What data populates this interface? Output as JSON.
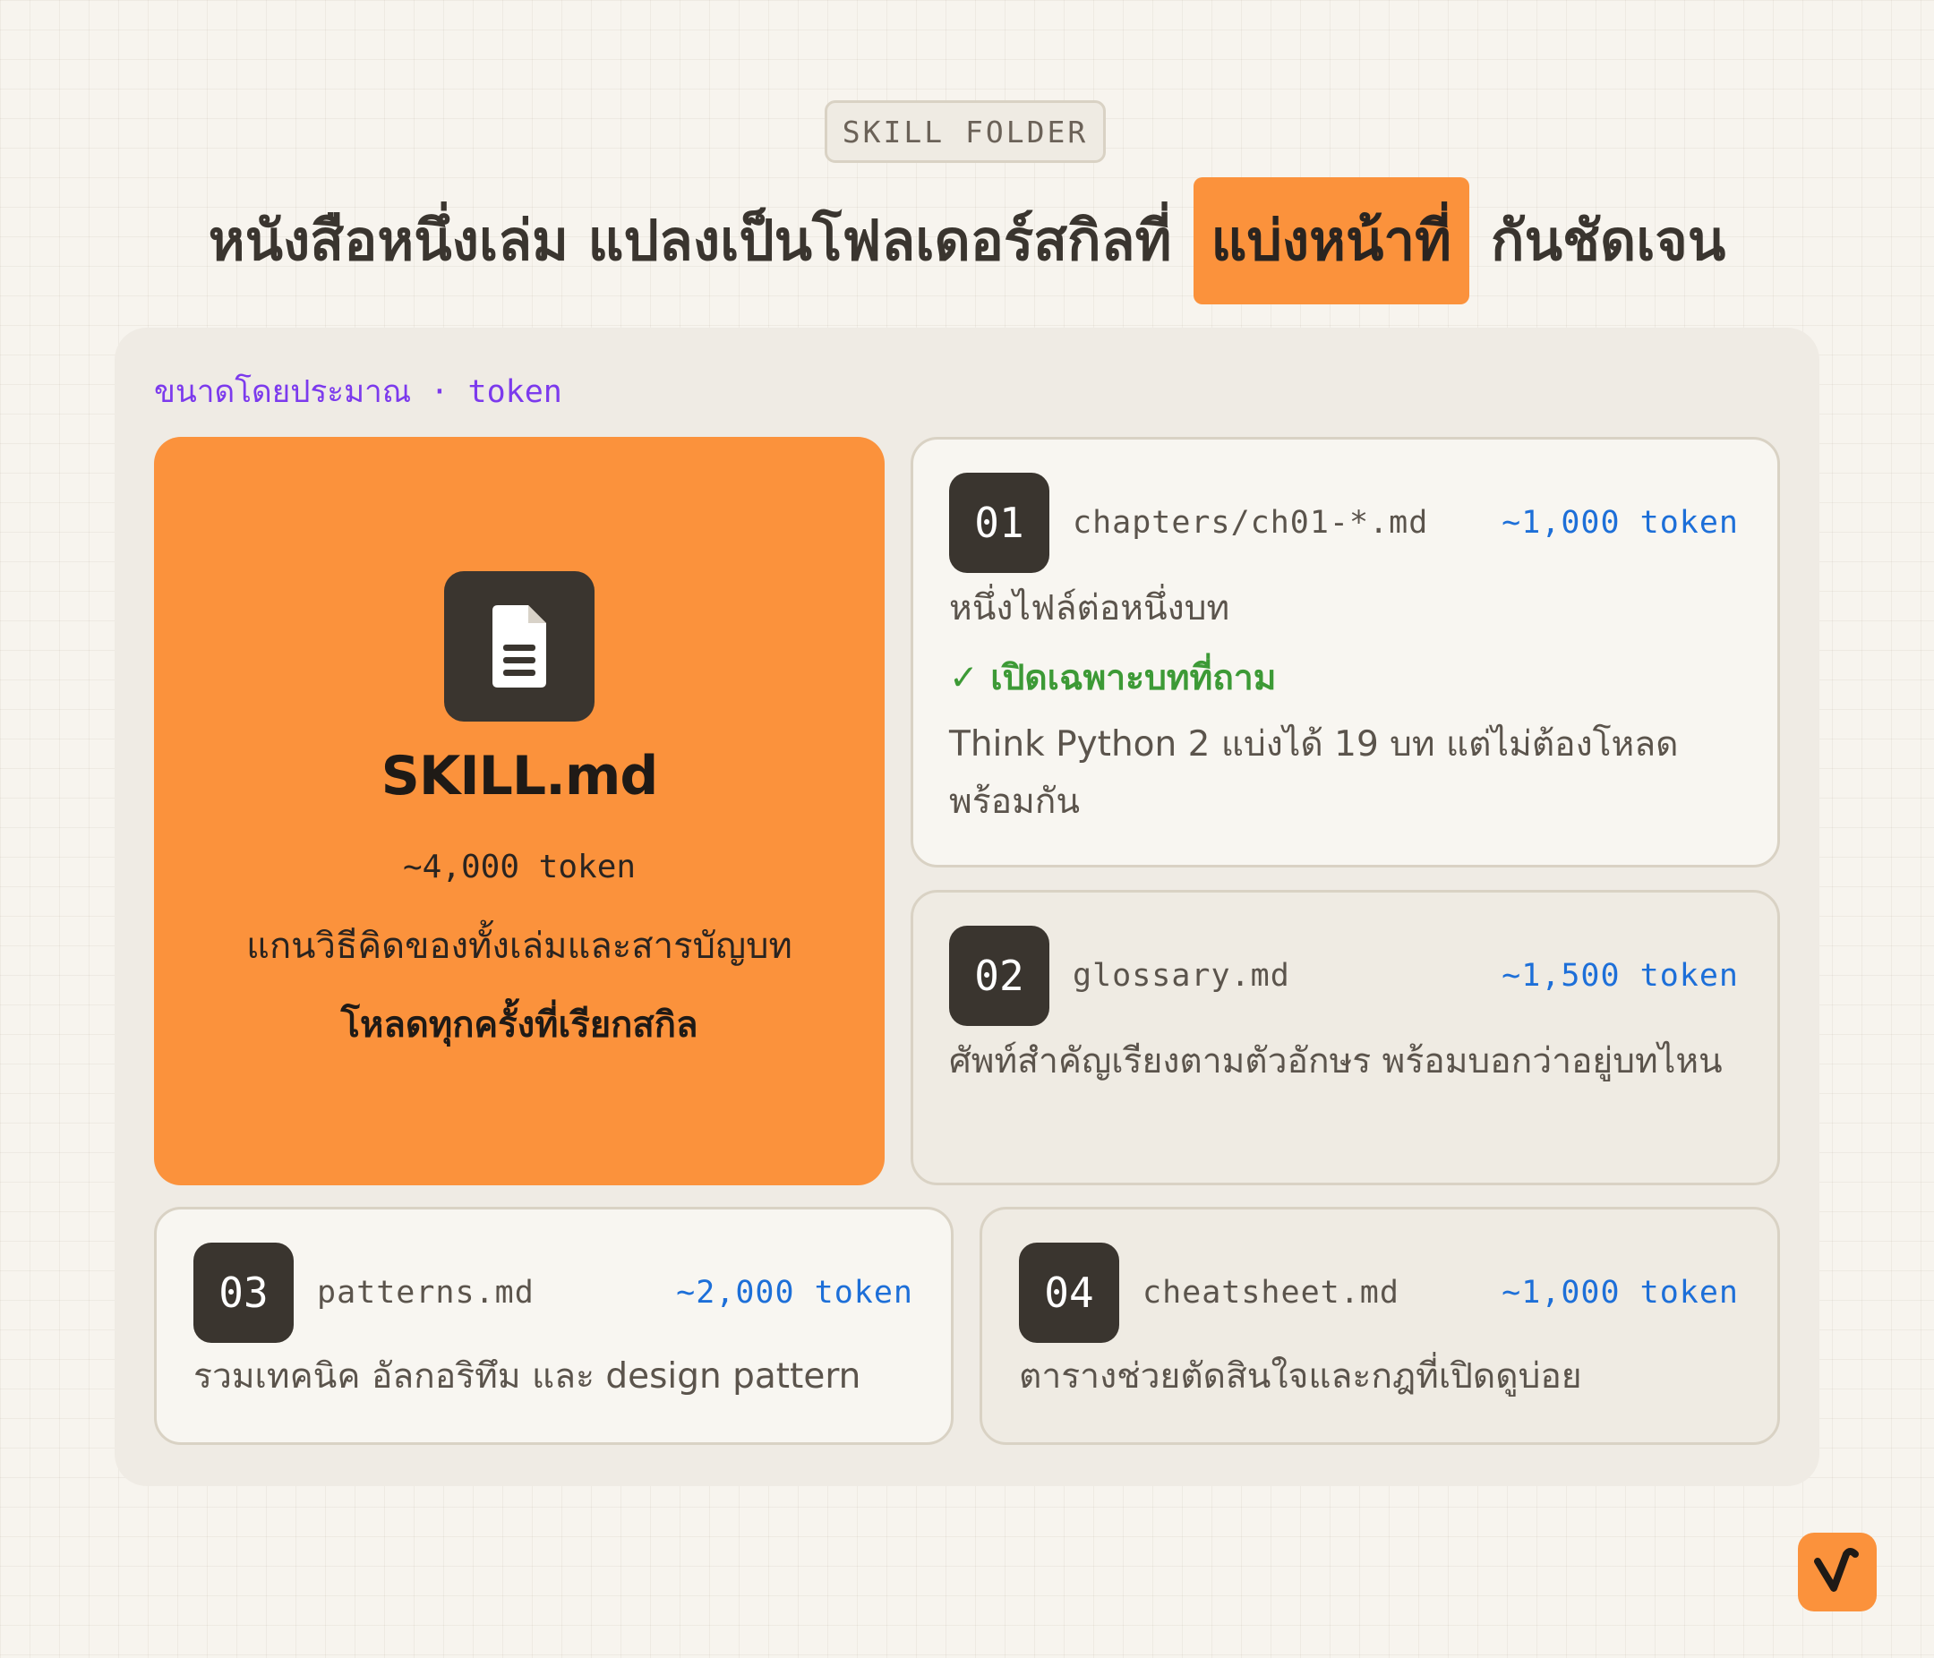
{
  "header": {
    "tag": "SKILL FOLDER",
    "title_before": "หนังสือหนึ่งเล่ม แปลงเป็นโฟลเดอร์สกิลที่",
    "title_highlight": "แบ่งหน้าที่",
    "title_after": "กันชัดเจน"
  },
  "size_label": "ขนาดโดยประมาณ · token",
  "skill": {
    "icon": "document-icon",
    "name": "SKILL.md",
    "tokens": "~4,000 token",
    "description": "แกนวิธีคิดของทั้งเล่มและสารบัญบท",
    "load_note": "โหลดทุกครั้งที่เรียกสกิล"
  },
  "files": [
    {
      "number": "01",
      "name": "chapters/ch01-*.md",
      "tokens": "~1,000 token",
      "description": "หนึ่งไฟล์ต่อหนึ่งบท",
      "check": "✓ เปิดเฉพาะบทที่ถาม",
      "note": "Think Python 2 แบ่งได้ 19 บท แต่ไม่ต้องโหลดพร้อมกัน"
    },
    {
      "number": "02",
      "name": "glossary.md",
      "tokens": "~1,500 token",
      "description": "ศัพท์สำคัญเรียงตามตัวอักษร พร้อมบอกว่าอยู่บทไหน"
    },
    {
      "number": "03",
      "name": "patterns.md",
      "tokens": "~2,000 token",
      "description": "รวมเทคนิค อัลกอริทึม และ design pattern"
    },
    {
      "number": "04",
      "name": "cheatsheet.md",
      "tokens": "~1,000 token",
      "description": "ตารางช่วยตัดสินใจและกฎที่เปิดดูบ่อย"
    }
  ],
  "colors": {
    "accent": "#fb923c",
    "token": "#1d6fd8",
    "label": "#7c3aed",
    "check": "#3d9a36",
    "dark": "#3a352f"
  },
  "logo": "brand-logo-icon"
}
